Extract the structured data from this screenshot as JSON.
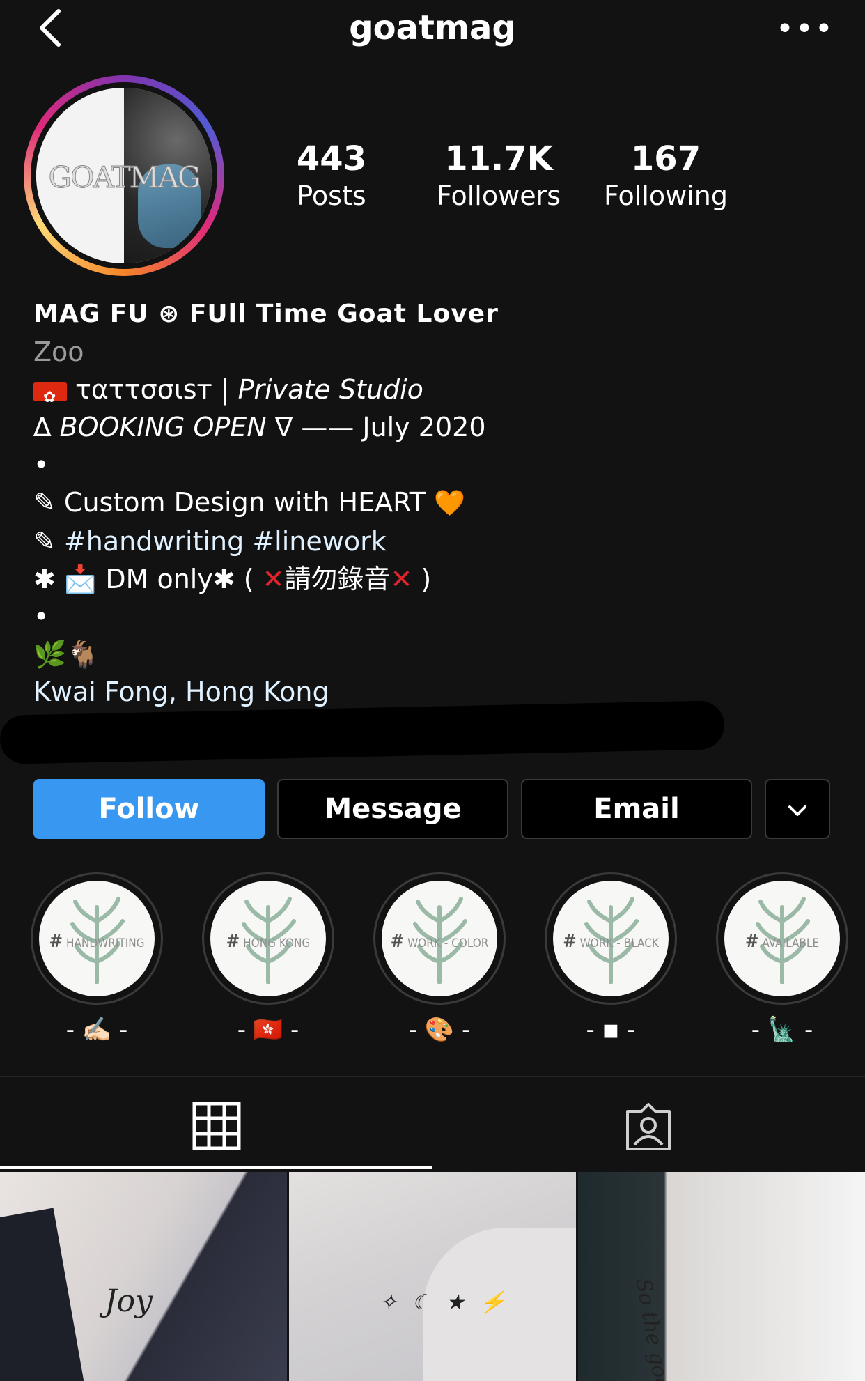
{
  "header": {
    "username": "goatmag",
    "more_label": "•••"
  },
  "avatar": {
    "logo_text": "GOATMAG"
  },
  "stats": [
    {
      "value": "443",
      "label": "Posts"
    },
    {
      "value": "11.7K",
      "label": "Followers"
    },
    {
      "value": "167",
      "label": "Following"
    }
  ],
  "bio": {
    "name": "MAG FU ⊛ FUll Time Goat Lover",
    "category": "Zoo",
    "line_studio_a": "ταττσσιѕт | ",
    "line_studio_b": "Private Studio",
    "line_booking_a": "∆ ",
    "line_booking_b": "BOOKING OPEN",
    "line_booking_c": " ∇ —— July 2020",
    "dot1": "•",
    "line_design": "✎ Custom Design with HEART ",
    "heart": "🧡",
    "line_tags_prefix": "✎ ",
    "tag1": "#handwriting",
    "tag2": " #linework",
    "line_dm_a": "✱ 📩 DM only✱ ( ",
    "dm_x": "✕",
    "dm_mid": "請勿錄音",
    "line_dm_end": " )",
    "dot2": "•",
    "emoji_line": "🌿🐐",
    "location": "Kwai Fong, Hong Kong"
  },
  "actions": {
    "follow": "Follow",
    "message": "Message",
    "email": "Email"
  },
  "highlights": [
    {
      "text": "HANDWRITING",
      "caption": "- ✍🏻 -"
    },
    {
      "text": "HONG KONG",
      "caption": "- 🇭🇰 -"
    },
    {
      "text": "WORK - COLOR",
      "caption": "- 🎨 -"
    },
    {
      "text": "WORK - BLACK",
      "caption": "- ◾ -"
    },
    {
      "text": "AVAILABLE",
      "caption": "- 🗽 -"
    }
  ],
  "posts": [
    {
      "caption": "Joy"
    },
    {
      "caption": "✧ ☾ ★ ⚡"
    },
    {
      "caption": "So the good"
    }
  ]
}
